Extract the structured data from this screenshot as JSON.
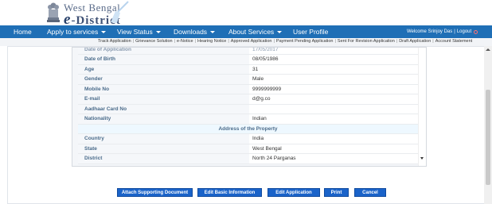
{
  "logo": {
    "line1": "West Bengal",
    "line2_e": "e",
    "line2_rest": "-District"
  },
  "nav": {
    "items": [
      {
        "label": "Home",
        "dropdown": false
      },
      {
        "label": "Apply to services",
        "dropdown": true
      },
      {
        "label": "View Status",
        "dropdown": true
      },
      {
        "label": "Downloads",
        "dropdown": true
      },
      {
        "label": "About Services",
        "dropdown": true
      },
      {
        "label": "User Profile",
        "dropdown": false
      }
    ],
    "welcome": "Welcome Srinjoy Das",
    "separator": "|",
    "logout": "Logout"
  },
  "sublinks": [
    "Track Application",
    "Grievance Solution",
    "e-Notice",
    "Hearing Notice",
    "Approved Application",
    "Payment Pending Application",
    "Sent For Revision Application",
    "Draft Application",
    "Account Statement"
  ],
  "details": {
    "rows": [
      {
        "label": "Date of Application",
        "value": "17/05/2017"
      },
      {
        "label": "Date of Birth",
        "value": "08/05/1986"
      },
      {
        "label": "Age",
        "value": "31"
      },
      {
        "label": "Gender",
        "value": "Male"
      },
      {
        "label": "Mobile No",
        "value": "9999999999"
      },
      {
        "label": "E-mail",
        "value": "d@g.co"
      },
      {
        "label": "Aadhaar Card No",
        "value": ""
      },
      {
        "label": "Nationality",
        "value": "Indian"
      }
    ],
    "section_title": "Address of the Property",
    "address_rows": [
      {
        "label": "Country",
        "value": "India"
      },
      {
        "label": "State",
        "value": "West Bengal"
      },
      {
        "label": "District",
        "value": "North 24 Parganas"
      }
    ]
  },
  "buttons": {
    "attach": "Attach Supporting Document",
    "edit_basic": "Edit Basic Information",
    "edit_app": "Edit Application",
    "print": "Print",
    "cancel": "Cancel"
  },
  "colors": {
    "nav_bg": "#1f6fb6",
    "button_bg": "#1a63c9",
    "label_text": "#4a6b8a"
  }
}
